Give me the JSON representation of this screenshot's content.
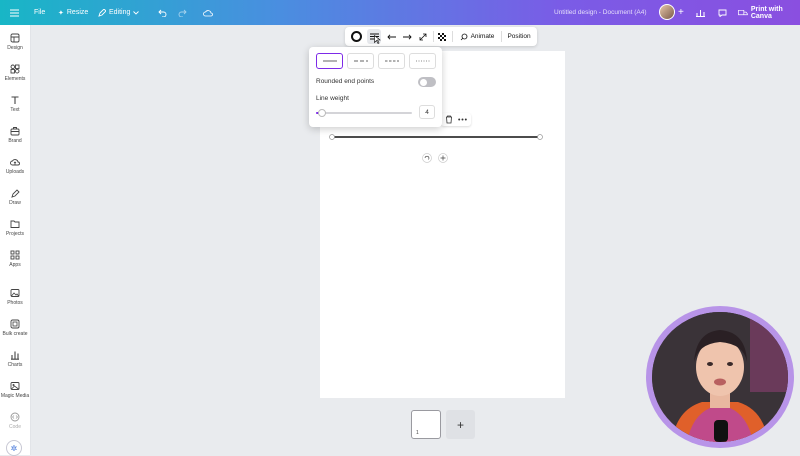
{
  "topbar": {
    "file_label": "File",
    "resize_label": "Resize",
    "editing_label": "Editing",
    "document_title": "Untitled design - Document (A4)",
    "print_label": "Print with Canva"
  },
  "sidebar": {
    "items": [
      {
        "label": "Design",
        "icon": "layout-icon"
      },
      {
        "label": "Elements",
        "icon": "shapes-icon"
      },
      {
        "label": "Text",
        "icon": "text-icon"
      },
      {
        "label": "Brand",
        "icon": "brand-icon"
      },
      {
        "label": "Uploads",
        "icon": "upload-cloud-icon"
      },
      {
        "label": "Draw",
        "icon": "pen-icon"
      },
      {
        "label": "Projects",
        "icon": "folder-icon"
      },
      {
        "label": "Apps",
        "icon": "apps-grid-icon"
      },
      {
        "label": "Photos",
        "icon": "photo-icon"
      },
      {
        "label": "Bulk create",
        "icon": "bulk-create-icon"
      },
      {
        "label": "Charts",
        "icon": "chart-icon"
      },
      {
        "label": "Magic Media",
        "icon": "magic-media-icon"
      },
      {
        "label": "Code",
        "icon": "code-icon"
      }
    ]
  },
  "toolbar": {
    "animate_label": "Animate",
    "position_label": "Position"
  },
  "line_popup": {
    "rounded_label": "Rounded end points",
    "rounded_enabled": false,
    "weight_label": "Line weight",
    "weight_value": "4",
    "styles": [
      "solid",
      "long-dash",
      "short-dash",
      "dotted"
    ],
    "selected_style": "solid"
  },
  "pages": {
    "current_page": "1"
  },
  "colors": {
    "accent": "#7d2ae8",
    "canvas_bg": "#e9ebee"
  }
}
